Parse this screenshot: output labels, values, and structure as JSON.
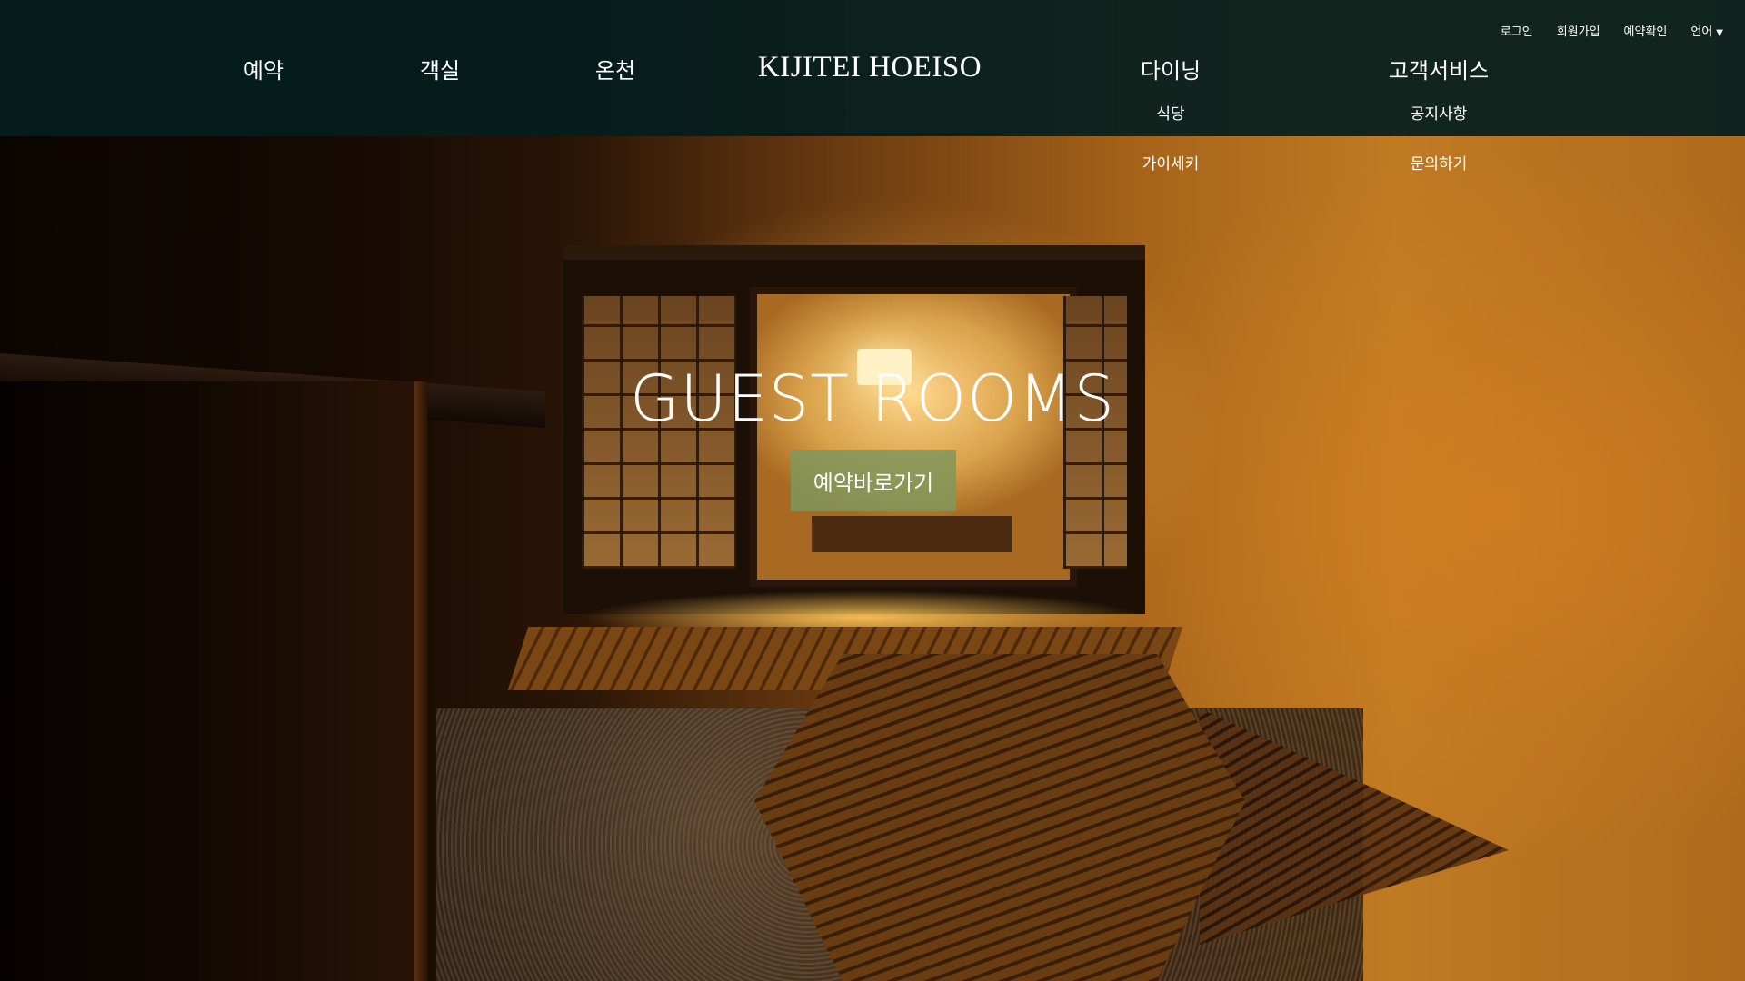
{
  "header": {
    "brand": "KIJITEI HOEISO",
    "util_nav": {
      "login": "로그인",
      "signup": "회원가입",
      "check_reservation": "예약확인",
      "language": "언어",
      "language_caret": "▼"
    },
    "main_nav": {
      "reservation": "예약",
      "rooms": "객실",
      "hot_spring": "온천",
      "dining": "다이닝",
      "customer_service": "고객서비스"
    },
    "dining_submenu": [
      "식당",
      "가이세키"
    ],
    "service_submenu": [
      "공지사항",
      "문의하기"
    ]
  },
  "hero": {
    "title": "GUEST ROOMS",
    "button_label": "예약바로가기",
    "button_color": "#80965a"
  },
  "colors": {
    "header_bg": "#041e1e",
    "text": "#ffffff"
  }
}
